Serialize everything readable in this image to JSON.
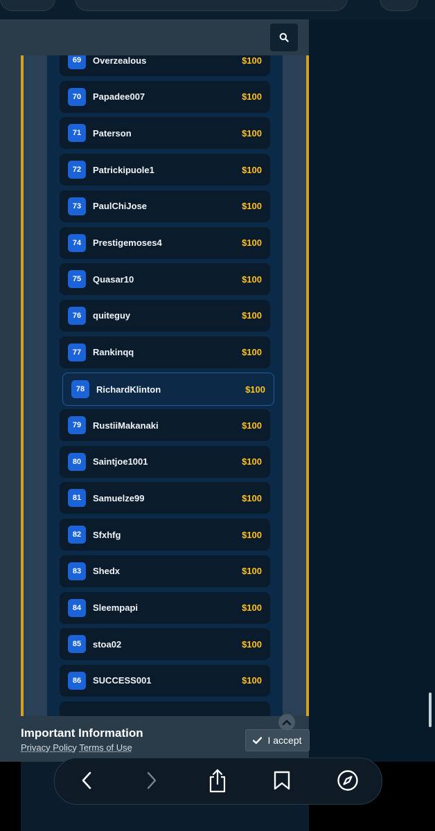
{
  "header": {
    "search_icon": "search-icon"
  },
  "leaderboard": [
    {
      "rank": "69",
      "name": "Overzealous",
      "amount": "$100"
    },
    {
      "rank": "70",
      "name": "Papadee007",
      "amount": "$100"
    },
    {
      "rank": "71",
      "name": "Paterson",
      "amount": "$100"
    },
    {
      "rank": "72",
      "name": "Patrickipuole1",
      "amount": "$100"
    },
    {
      "rank": "73",
      "name": "PaulChiJose",
      "amount": "$100"
    },
    {
      "rank": "74",
      "name": "Prestigemoses4",
      "amount": "$100"
    },
    {
      "rank": "75",
      "name": "Quasar10",
      "amount": "$100"
    },
    {
      "rank": "76",
      "name": "quiteguy",
      "amount": "$100"
    },
    {
      "rank": "77",
      "name": "Rankinqq",
      "amount": "$100"
    },
    {
      "rank": "78",
      "name": "RichardKlinton",
      "amount": "$100",
      "highlighted": true
    },
    {
      "rank": "79",
      "name": "RustiiMakanaki",
      "amount": "$100"
    },
    {
      "rank": "80",
      "name": "Saintjoe1001",
      "amount": "$100"
    },
    {
      "rank": "81",
      "name": "Samuelze99",
      "amount": "$100"
    },
    {
      "rank": "82",
      "name": "Sfxhfg",
      "amount": "$100"
    },
    {
      "rank": "83",
      "name": "Shedx",
      "amount": "$100"
    },
    {
      "rank": "84",
      "name": "Sleempapi",
      "amount": "$100"
    },
    {
      "rank": "85",
      "name": "stoa02",
      "amount": "$100"
    },
    {
      "rank": "86",
      "name": "SUCCESS001",
      "amount": "$100"
    }
  ],
  "info_banner": {
    "title": "Important Information",
    "privacy_link": "Privacy Policy",
    "terms_link": "Terms of Use",
    "accept_label": "I accept"
  },
  "toolbar": {
    "icons": [
      "back-icon",
      "forward-icon",
      "share-icon",
      "bookmark-icon",
      "compass-icon"
    ]
  },
  "colors": {
    "accent_gold": "#d4a21f",
    "amount_yellow": "#ffc21a",
    "rank_blue": "#1b63d6",
    "row_bg": "#0a1b2c"
  }
}
